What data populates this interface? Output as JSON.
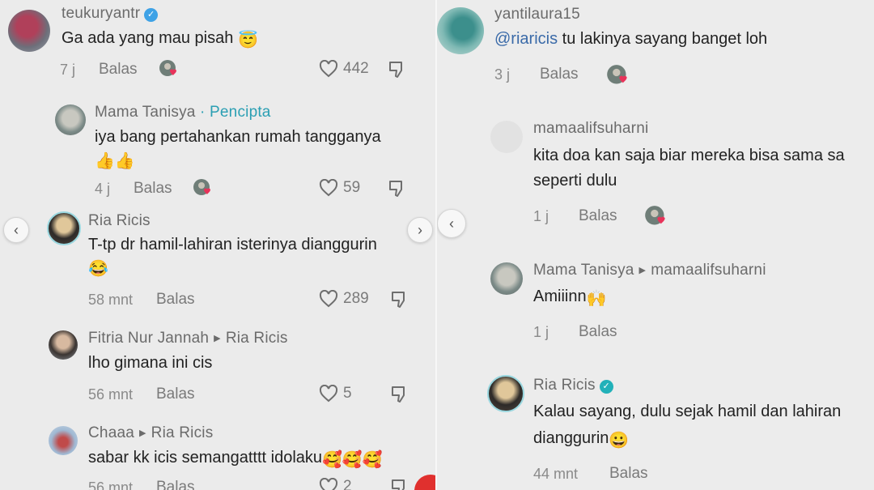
{
  "left": {
    "comments": [
      {
        "user": "teukuryantr",
        "verified": true,
        "text": "Ga ada yang mau pisah",
        "emoji": "😇",
        "time": "7 j",
        "reply": "Balas",
        "likes": "442"
      },
      {
        "user": "Mama Tanisya",
        "creator_tag": "· Pencipta",
        "text": "iya bang pertahankan rumah tangganya",
        "emoji": "👍👍",
        "time": "4 j",
        "reply": "Balas",
        "likes": "59"
      },
      {
        "user": "Ria Ricis",
        "text": "T-tp dr hamil-lahiran isterinya dianggurin",
        "emoji": "😂",
        "time": "58 mnt",
        "reply": "Balas",
        "likes": "289"
      },
      {
        "user": "Fitria Nur Jannah",
        "reply_to": "Ria Ricis",
        "text": "lho gimana ini cis",
        "time": "56 mnt",
        "reply": "Balas",
        "likes": "5"
      },
      {
        "user": "Chaaa",
        "reply_to": "Ria Ricis",
        "text": "sabar kk icis semangatttt idolaku",
        "emoji": "🥰🥰🥰",
        "time": "56 mnt",
        "reply": "Balas",
        "likes": "2"
      }
    ]
  },
  "right": {
    "comments": [
      {
        "user": "yantilaura15",
        "mention": "@riaricis",
        "text": " tu lakinya sayang banget loh",
        "time": "3 j",
        "reply": "Balas"
      },
      {
        "user": "mamaalifsuharni",
        "text_line1": "kita doa kan saja biar mereka bisa sama sa",
        "text_line2": "seperti dulu",
        "time": "1 j",
        "reply": "Balas"
      },
      {
        "user": "Mama Tanisya",
        "reply_to": "mamaalifsuharni",
        "text": "Amiiinn",
        "emoji": "🙌",
        "time": "1 j",
        "reply": "Balas"
      },
      {
        "user": "Ria Ricis",
        "verified": true,
        "text_line1": "Kalau sayang, dulu sejak hamil dan lahiran",
        "text_line2": "dianggurin",
        "emoji": "😀",
        "time": "44 mnt",
        "reply": "Balas"
      }
    ]
  },
  "colors": {
    "creator": "#2b9fb3",
    "mention": "#3a6aa8",
    "verified": "#3ea2e6",
    "heart": "#e8335a"
  }
}
